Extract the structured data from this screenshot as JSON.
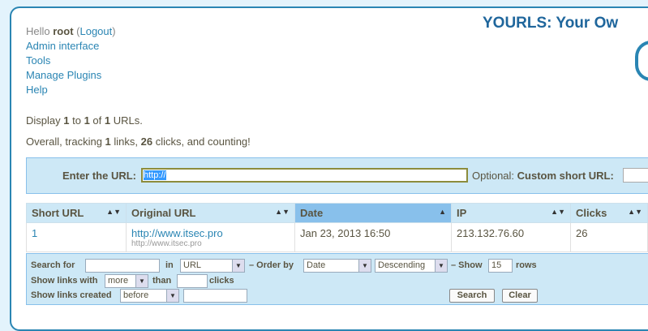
{
  "app_title": "YOURLS: Your Ow",
  "nav": {
    "hello_prefix": "Hello",
    "user": "root",
    "logout": "Logout",
    "links": [
      "Admin interface",
      "Tools",
      "Manage Plugins",
      "Help"
    ]
  },
  "summary": {
    "display": [
      "Display ",
      "1",
      " to ",
      "1",
      " of ",
      "1",
      " URLs."
    ],
    "tracking": [
      "Overall, tracking ",
      "1",
      " links, ",
      "26",
      " clicks, and counting!"
    ]
  },
  "add_form": {
    "url_label": "Enter the URL:",
    "url_value": "http://",
    "optional_label": "Optional: ",
    "custom_label": "Custom short URL:"
  },
  "table": {
    "headers": [
      "Short URL",
      "Original URL",
      "Date",
      "IP",
      "Clicks"
    ],
    "sorted_column": "Date",
    "rows": [
      {
        "short_url": "1",
        "original_url": "http://www.itsec.pro",
        "original_sub": "http://www.itsec.pro",
        "date": "Jan 23, 2013 16:50",
        "ip": "213.132.76.60",
        "clicks": "26"
      }
    ]
  },
  "filter": {
    "search_for": "Search for",
    "in": "in",
    "search_field": "URL",
    "order_by": "– Order by",
    "order_field": "Date",
    "order_dir": "Descending",
    "show": "– Show",
    "rows_value": "15",
    "rows": "rows",
    "links_with": "Show links with",
    "more": "more",
    "than": "than",
    "clicks": "clicks",
    "links_created": "Show links created",
    "before": "before",
    "search_btn": "Search",
    "clear_btn": "Clear"
  },
  "colors": {
    "accent": "#2a85b3",
    "header_bg": "#cde8f6",
    "sorted_bg": "#88c0eb"
  }
}
